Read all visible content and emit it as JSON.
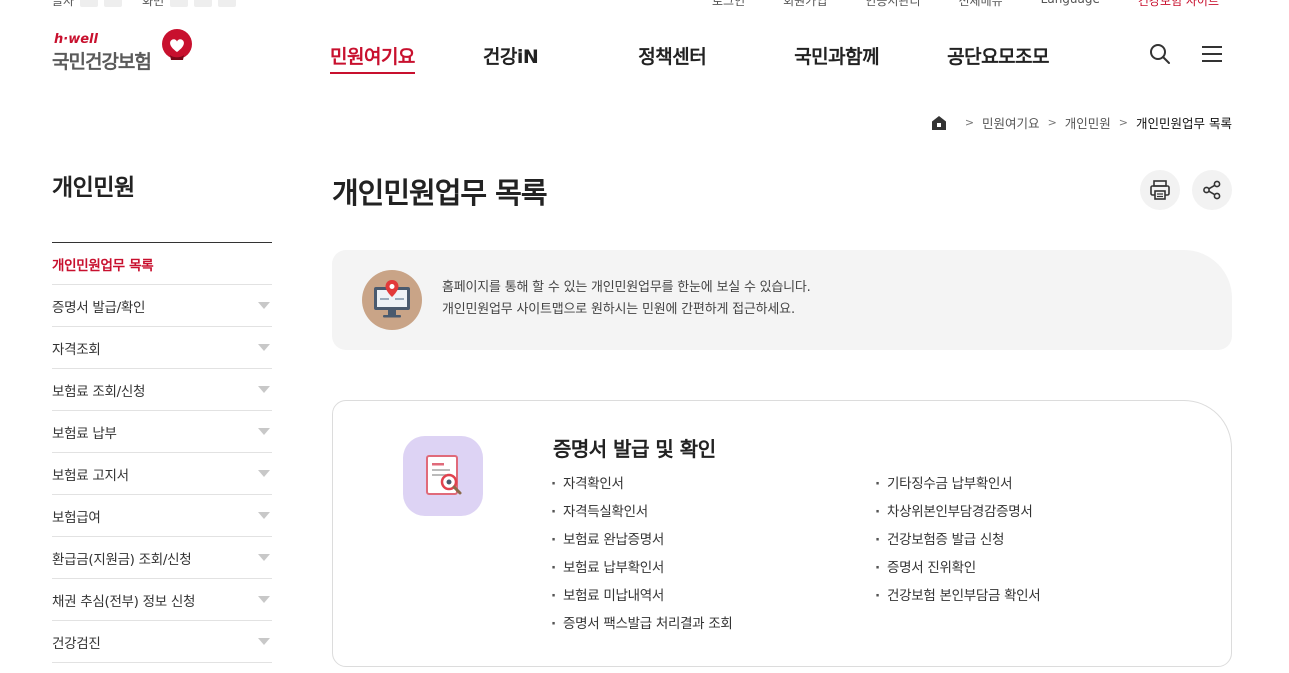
{
  "utility": {
    "left_label_1": "글자",
    "left_label_2": "화면",
    "links": [
      "로그인",
      "회원가입",
      "인증서관리",
      "전체메뉴",
      "Language"
    ],
    "highlight_link": "건강보험 사이트"
  },
  "header": {
    "logo_sub": "h·well",
    "logo_main": "국민건강보험",
    "gnb": [
      "민원여기요",
      "건강iN",
      "정책센터",
      "국민과함께",
      "공단요모조모"
    ],
    "icons": [
      "search-icon",
      "hamburger-menu-icon"
    ]
  },
  "breadcrumb": {
    "items": [
      "민원여기요",
      "개인민원"
    ],
    "current": "개인민원업무 목록"
  },
  "lnb": {
    "title": "개인민원",
    "items": [
      {
        "label": "개인민원업무 목록",
        "active": true
      },
      {
        "label": "증명서 발급/확인",
        "active": false
      },
      {
        "label": "자격조회",
        "active": false
      },
      {
        "label": "보험료 조회/신청",
        "active": false
      },
      {
        "label": "보험료 납부",
        "active": false
      },
      {
        "label": "보험료 고지서",
        "active": false
      },
      {
        "label": "보험급여",
        "active": false
      },
      {
        "label": "환급금(지원금) 조회/신청",
        "active": false
      },
      {
        "label": "채권 추심(전부) 정보 신청",
        "active": false
      },
      {
        "label": "건강검진",
        "active": false
      }
    ]
  },
  "content": {
    "title": "개인민원업무 목록",
    "intro_line1": "홈페이지를 통해 할 수 있는 개인민원업무를 한눈에 보실 수 있습니다.",
    "intro_line2": "개인민원업무 사이트맵으로 원하시는 민원에 간편하게 접근하세요.",
    "card": {
      "title": "증명서 발급 및 확인",
      "left": [
        "자격확인서",
        "자격득실확인서",
        "보험료 완납증명서",
        "보험료 납부확인서",
        "보험료 미납내역서",
        "증명서 팩스발급 처리결과 조회"
      ],
      "right": [
        "기타징수금 납부확인서",
        "차상위본인부담경감증명서",
        "건강보험증 발급 신청",
        "증명서 진위확인",
        "건강보험 본인부담금 확인서"
      ]
    }
  },
  "colors": {
    "brand_red": "#c8102e",
    "intro_bg": "#f4f4f4",
    "card_icon_bg": "#ddd3f4",
    "intro_icon_bg": "#c9a487"
  }
}
